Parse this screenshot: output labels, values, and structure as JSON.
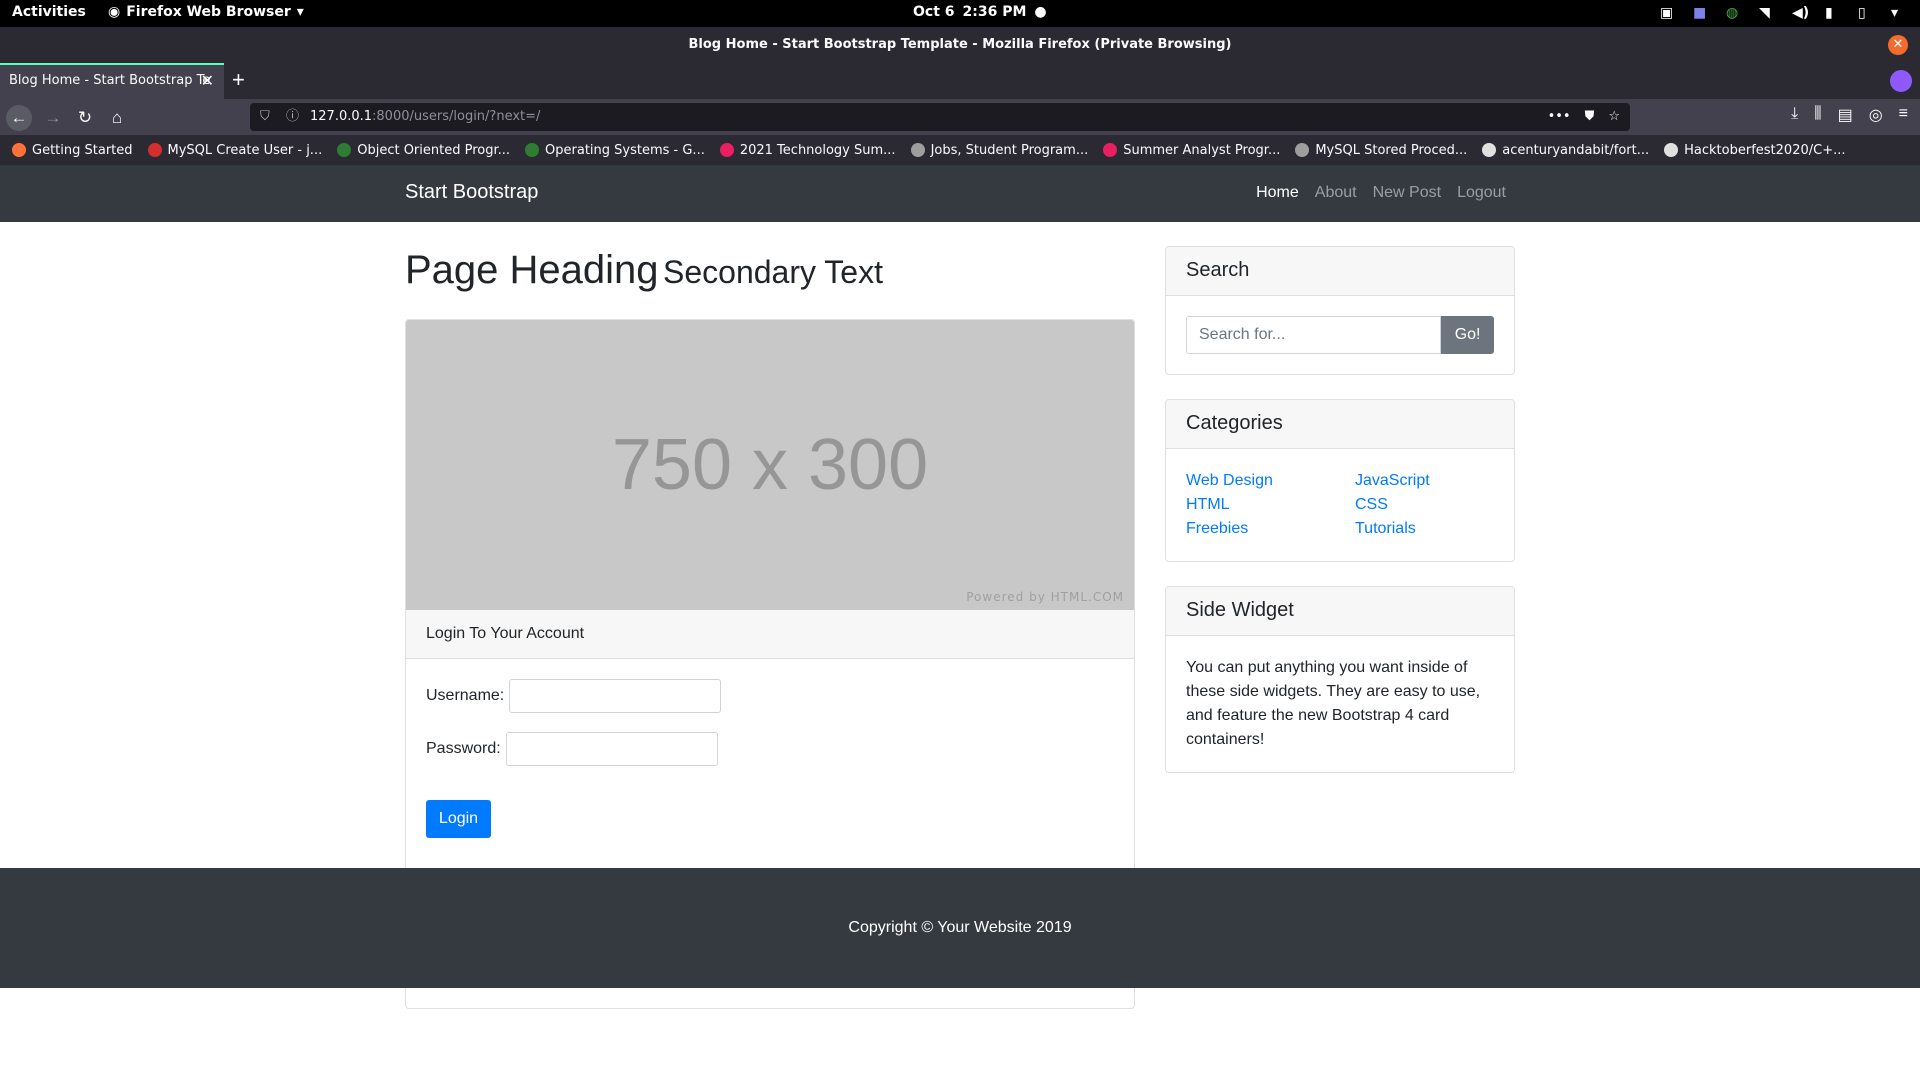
{
  "os_bar": {
    "activities": "Activities",
    "app_name": "Firefox Web Browser",
    "date": "Oct 6",
    "time": "2:36 PM"
  },
  "browser": {
    "window_title": "Blog Home - Start Bootstrap Template - Mozilla Firefox (Private Browsing)",
    "tab_title": "Blog Home - Start Bootstrap Te",
    "url_host": "127.0.0.1",
    "url_rest": ":8000/users/login/?next=/",
    "bookmarks": [
      {
        "label": "Getting Started",
        "icon": "firefox-icon",
        "color": "#ff7139"
      },
      {
        "label": "MySQL Create User - j...",
        "icon": "bookmark-red-icon",
        "color": "#d32f2f"
      },
      {
        "label": "Object Oriented Progr...",
        "icon": "bookmark-green-icon",
        "color": "#2e7d32"
      },
      {
        "label": "Operating Systems - G...",
        "icon": "bookmark-green-icon",
        "color": "#2e7d32"
      },
      {
        "label": "2021 Technology Sum...",
        "icon": "bookmark-pink-icon",
        "color": "#e91e63"
      },
      {
        "label": "Jobs, Student Program...",
        "icon": "globe-icon",
        "color": "#9e9e9e"
      },
      {
        "label": "Summer Analyst Progr...",
        "icon": "bookmark-pink-icon",
        "color": "#e91e63"
      },
      {
        "label": "MySQL Stored Proced...",
        "icon": "globe-icon",
        "color": "#9e9e9e"
      },
      {
        "label": "acenturyandabit/fort...",
        "icon": "github-icon",
        "color": "#e0e0e0"
      },
      {
        "label": "Hacktoberfest2020/C+...",
        "icon": "github-icon",
        "color": "#e0e0e0"
      }
    ]
  },
  "site": {
    "brand": "Start Bootstrap",
    "nav": [
      {
        "label": "Home",
        "active": true
      },
      {
        "label": "About",
        "active": false
      },
      {
        "label": "New Post",
        "active": false
      },
      {
        "label": "Logout",
        "active": false
      }
    ],
    "heading": "Page Heading",
    "heading_secondary": "Secondary Text",
    "placeholder_image": {
      "dims": "750 x 300",
      "powered": "Powered by HTML.COM"
    },
    "login_card": {
      "header": "Login To Your Account",
      "username_label": "Username:",
      "password_label": "Password:",
      "button": "Login"
    },
    "search_widget": {
      "title": "Search",
      "placeholder": "Search for...",
      "button": "Go!"
    },
    "categories_widget": {
      "title": "Categories",
      "items": [
        "Web Design",
        "JavaScript",
        "HTML",
        "CSS",
        "Freebies",
        "Tutorials"
      ]
    },
    "side_widget": {
      "title": "Side Widget",
      "text": "You can put anything you want inside of these side widgets. They are easy to use, and feature the new Bootstrap 4 card containers!"
    },
    "footer": "Copyright © Your Website 2019"
  },
  "colors": {
    "primary": "#007bff",
    "dark": "#343a40",
    "secondary": "#6c757d"
  }
}
